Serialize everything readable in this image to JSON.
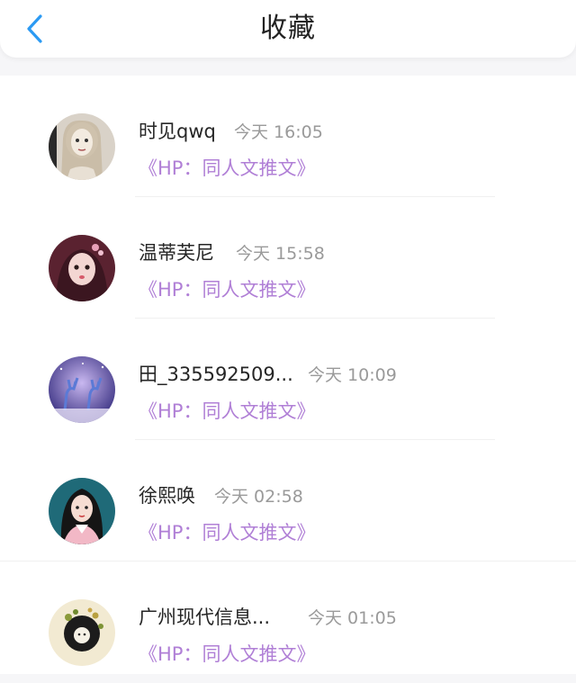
{
  "header": {
    "title": "收藏",
    "back_icon": "chevron-left-icon",
    "accent_color": "#2b9af3"
  },
  "favorites": [
    {
      "name": "时见qwq",
      "time": "今天 16:05",
      "work": "《HP：同人文推文》"
    },
    {
      "name": "温蒂芙尼",
      "time": "今天 15:58",
      "work": "《HP：同人文推文》"
    },
    {
      "name": "田_335592509...",
      "time": "今天 10:09",
      "work": "《HP：同人文推文》"
    },
    {
      "name": "徐熙唤",
      "time": "今天 02:58",
      "work": "《HP：同人文推文》"
    },
    {
      "name": "广州现代信息...",
      "time": "今天 01:05",
      "work": "《HP：同人文推文》"
    }
  ],
  "colors": {
    "work_title": "#b07fd6",
    "time": "#9a9a9a",
    "name": "#262626"
  }
}
